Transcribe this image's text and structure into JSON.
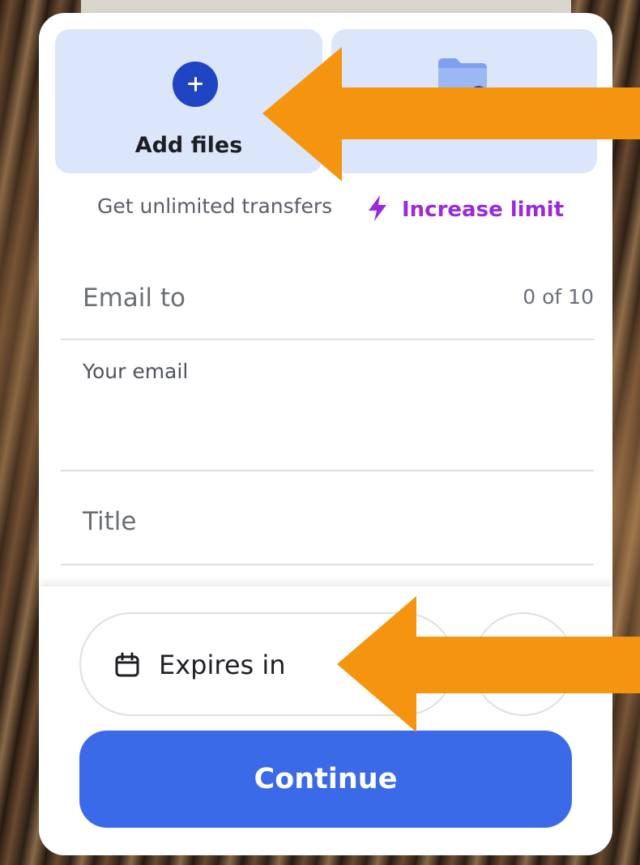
{
  "upload": {
    "add_files_label": "Add files",
    "add_icon": "plus-circle-icon",
    "folder_icon": "folder-icon"
  },
  "limit": {
    "text": "Get unlimited transfers",
    "icon": "lightning-bolt-icon",
    "link_label": "Increase limit",
    "link_color": "#9b2bd9"
  },
  "form": {
    "email_to_label": "Email to",
    "email_count": "0 of 10",
    "your_email_label": "Your email",
    "title_label": "Title"
  },
  "options": {
    "expires_label": "Expires in",
    "expires_icon": "calendar-icon"
  },
  "actions": {
    "continue_label": "Continue",
    "continue_color": "#3b6ae8"
  },
  "annotations": {
    "arrow_color": "#f5950f",
    "arrows": [
      "arrow-pointing-add-files",
      "arrow-pointing-expires-in"
    ]
  }
}
